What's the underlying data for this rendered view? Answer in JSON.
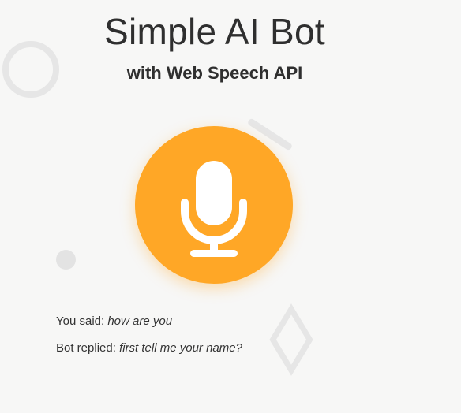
{
  "header": {
    "title": "Simple AI Bot",
    "subtitle": "with Web Speech API"
  },
  "mic_button": {
    "icon": "microphone-icon",
    "color": "#ffa726",
    "icon_color": "#ffffff"
  },
  "conversation": {
    "you_said_label": "You said:",
    "you_said_value": "how are you",
    "bot_replied_label": "Bot replied:",
    "bot_replied_value": "first tell me your name?"
  },
  "colors": {
    "background": "#f7f7f6",
    "text": "#333333",
    "decoration": "#e6e6e6"
  }
}
